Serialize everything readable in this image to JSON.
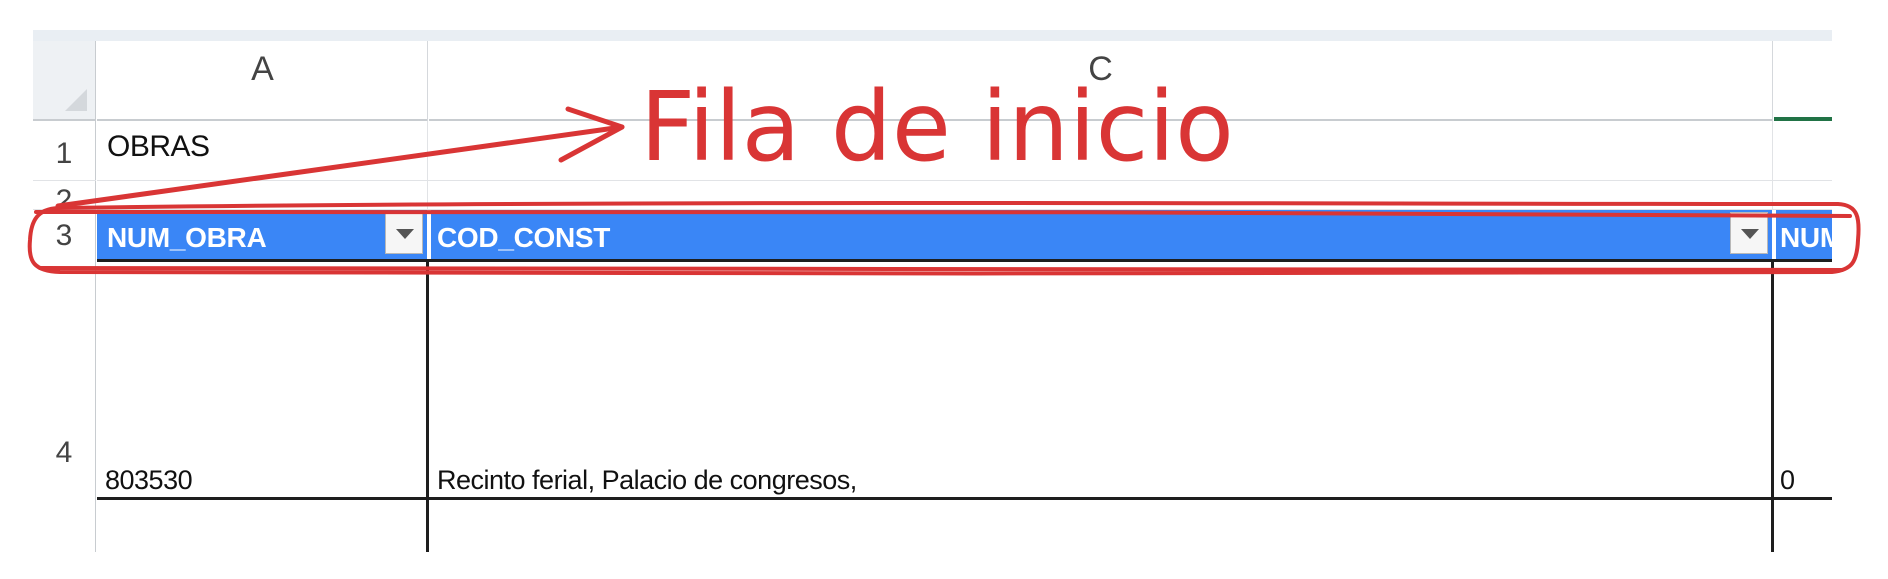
{
  "columns": {
    "a_label": "A",
    "c_label": "C"
  },
  "rows": {
    "r1": "1",
    "r2": "2",
    "r3": "3",
    "r4": "4"
  },
  "cells": {
    "a1": "OBRAS",
    "a4": "803530",
    "c4": "Recinto ferial, Palacio de congresos,",
    "d4": "0"
  },
  "table_headers": {
    "col1": "NUM_OBRA",
    "col2": "COD_CONST",
    "col3": "NUM_"
  },
  "annotation": {
    "text": "Fila de inicio",
    "color": "#d93535"
  },
  "colors": {
    "header_fill": "#3a86f6",
    "selected_column_accent": "#217346"
  },
  "icons": {
    "filter": "filter-dropdown-icon",
    "corner": "select-all-triangle-icon"
  }
}
